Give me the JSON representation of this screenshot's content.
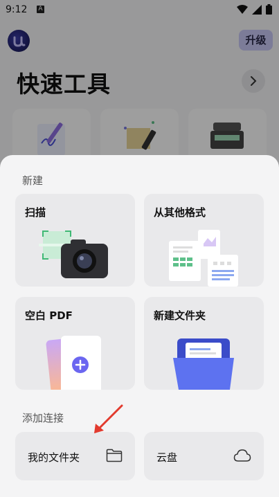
{
  "status_bar": {
    "time": "9:12",
    "notif_letter": "A"
  },
  "header": {
    "upgrade_label": "升级"
  },
  "quick_tools": {
    "title": "快速工具"
  },
  "sheet": {
    "new_section_label": "新建",
    "cards": [
      {
        "label": "扫描"
      },
      {
        "label": "从其他格式"
      },
      {
        "label": "空白 PDF"
      },
      {
        "label": "新建文件夹"
      }
    ],
    "connect_section_label": "添加连接",
    "connections": [
      {
        "label": "我的文件夹"
      },
      {
        "label": "云盘"
      }
    ]
  },
  "colors": {
    "accent": "#6b66f0",
    "upgrade_bg": "#c9c8f5",
    "arrow": "#e23a2e"
  }
}
